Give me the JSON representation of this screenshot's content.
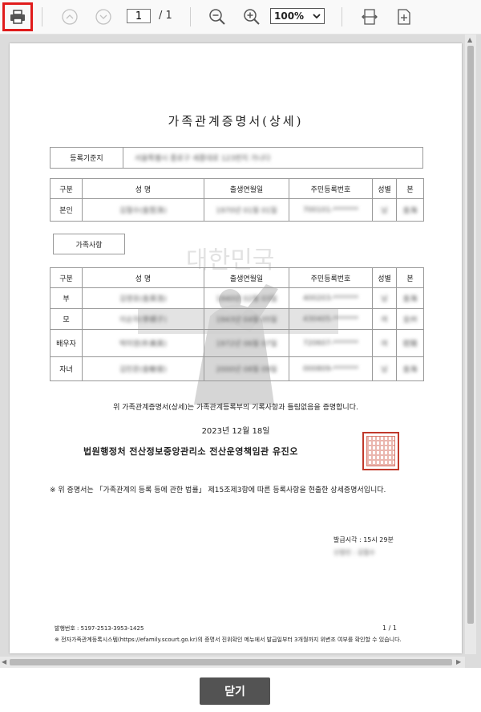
{
  "toolbar": {
    "icons": [
      "printer-icon",
      "prev-page-icon",
      "next-page-icon",
      "zoom-out-icon",
      "zoom-in-icon",
      "fit-width-icon",
      "fit-page-icon"
    ],
    "current_page": "1",
    "total_pages": "/ 1",
    "zoom": "100%"
  },
  "document": {
    "title": "가족관계증명서(상세)",
    "registration_label": "등록기준지",
    "registration_value": "서울특별시 종로구 세종대로 123번지 가나다",
    "main_table": {
      "headers": [
        "구분",
        "성 명",
        "출생연월일",
        "주민등록번호",
        "성별",
        "본"
      ],
      "rows": [
        [
          "본인",
          "김철수(金哲洙)",
          "1970년 01월 01일",
          "700101-*******",
          "남",
          "金海"
        ]
      ]
    },
    "family_label": "가족사항",
    "family_table": {
      "headers": [
        "구분",
        "성 명",
        "출생연월일",
        "주민등록번호",
        "성별",
        "본"
      ],
      "rows": [
        [
          "부",
          "김영호(金英浩)",
          "1940년 02월 03일",
          "400203-*******",
          "남",
          "金海"
        ],
        [
          "모",
          "이순자(李順子)",
          "1943년 04월 05일",
          "430405-*******",
          "여",
          "全州"
        ],
        [
          "배우자",
          "박미영(朴美英)",
          "1972년 06월 07일",
          "720607-*******",
          "여",
          "密陽"
        ],
        [
          "자녀",
          "김민준(金敏俊)",
          "2000년 08월 09일",
          "000809-*******",
          "남",
          "金海"
        ]
      ]
    },
    "cert_statement": "위 가족관계증명서(상세)는 가족관계등록부의 기록사항과 틀림없음을 증명합니다.",
    "date": "2023년 12월 18일",
    "issuer": "법원행정처 전산정보중앙관리소 전산운영책임관 유진오",
    "note": "※ 위 증명서는 「가족관계의 등록 등에 관한 법률」 제15조제3항에 따른 등록사항을 현출한 상세증명서입니다.",
    "issue_time": "발급시각 : 15시 29분",
    "applicant": "신청인 : 김철수",
    "issue_number": "발행번호 : 5197-2513-3953-1425",
    "page_indicator": "1 / 1",
    "footer_note": "※ 전자가족관계등록시스템(https://efamily.scourt.go.kr)의 증명서 진위확인 메뉴에서 발급일부터 3개월까지 위변조 여부를 확인할 수 있습니다.",
    "watermark_text": "대한민국"
  },
  "close_label": "닫기",
  "colors": {
    "highlight": "#e01b1b",
    "seal": "#c0392b",
    "close_button": "#535353"
  }
}
